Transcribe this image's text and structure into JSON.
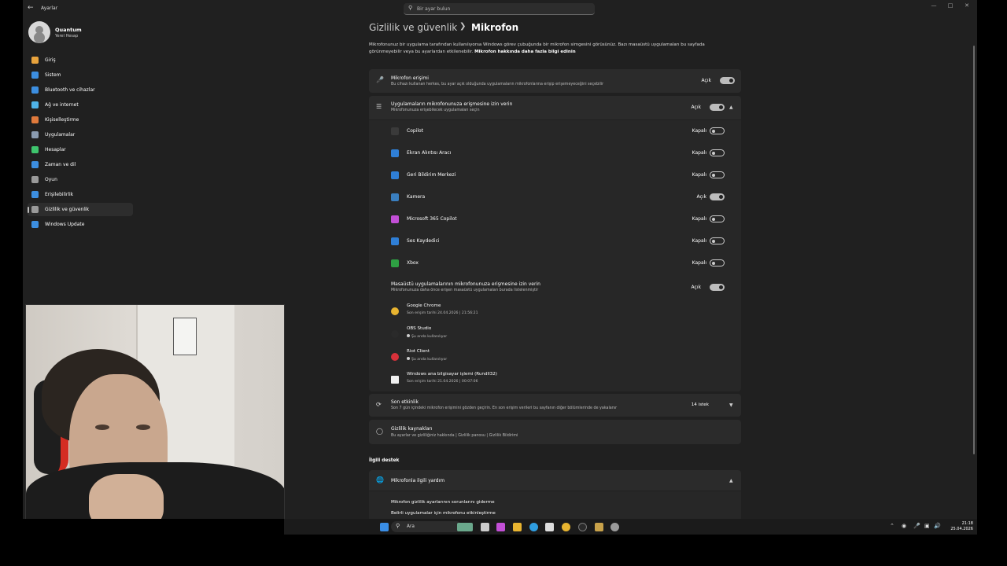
{
  "window": {
    "app_title": "Ayarlar",
    "search_placeholder": "Bir ayar bulun"
  },
  "account": {
    "name": "Quantum",
    "type": "Yerel Hesap"
  },
  "sidebar": {
    "items": [
      {
        "label": "Giriş",
        "icon": "home-icon",
        "color": "#e8a33d"
      },
      {
        "label": "Sistem",
        "icon": "system-icon",
        "color": "#3c8ee0"
      },
      {
        "label": "Bluetooth ve cihazlar",
        "icon": "bluetooth-icon",
        "color": "#3c8ee0"
      },
      {
        "label": "Ağ ve internet",
        "icon": "network-icon",
        "color": "#4fb3e8"
      },
      {
        "label": "Kişiselleştirme",
        "icon": "brush-icon",
        "color": "#e07a3c"
      },
      {
        "label": "Uygulamalar",
        "icon": "apps-icon",
        "color": "#8a9bb0"
      },
      {
        "label": "Hesaplar",
        "icon": "account-icon",
        "color": "#3ec46d"
      },
      {
        "label": "Zaman ve dil",
        "icon": "globe-clock-icon",
        "color": "#3c8ee0"
      },
      {
        "label": "Oyun",
        "icon": "gamepad-icon",
        "color": "#9a9a9a"
      },
      {
        "label": "Erişilebilirlik",
        "icon": "accessibility-icon",
        "color": "#3c8ee0"
      },
      {
        "label": "Gizlilik ve güvenlik",
        "icon": "shield-icon",
        "color": "#9a9a9a"
      },
      {
        "label": "Windows Update",
        "icon": "update-icon",
        "color": "#3c8ee0"
      }
    ]
  },
  "page": {
    "breadcrumb_parent": "Gizlilik ve güvenlik",
    "breadcrumb_current": "Mikrofon",
    "description": "Mikrofonunuz bir uygulama tarafından kullanılıyorsa Windows görev çubuğunda bir mikrofon simgesini görüsünüz. Bazı masaüstü uygulamaları bu sayfada görünmeyebilir veya bu ayarlardan etkilenebilir.",
    "description_link": "Mikrofon hakkında daha fazla bilgi edinin"
  },
  "mic_access": {
    "title": "Mikrofon erişimi",
    "subtitle": "Bu cihazı kullanan herkes, bu ayar açık olduğunda uygulamaların mikrofonlarına erişip erişemeyeceğini seçebilir",
    "state": "Açık"
  },
  "app_access": {
    "title": "Uygulamaların mikrofonunuza erişmesine izin verin",
    "subtitle": "Mikrofonunuza erişebilecek uygulamaları seçin",
    "state": "Açık",
    "apps": [
      {
        "name": "Copilot",
        "state": "Kapalı",
        "on": false,
        "icon": "copilot-icon",
        "color": "#3a3a3a"
      },
      {
        "name": "Ekran Alıntısı Aracı",
        "state": "Kapalı",
        "on": false,
        "icon": "snipping-tool-icon",
        "color": "#2f7fd6"
      },
      {
        "name": "Geri Bildirim Merkezi",
        "state": "Kapalı",
        "on": false,
        "icon": "feedback-hub-icon",
        "color": "#2f7fd6"
      },
      {
        "name": "Kamera",
        "state": "Açık",
        "on": true,
        "icon": "camera-icon",
        "color": "#3a7fc0"
      },
      {
        "name": "Microsoft 365 Copilot",
        "state": "Kapalı",
        "on": false,
        "icon": "m365-copilot-icon",
        "color": "#c24fd6"
      },
      {
        "name": "Ses Kaydedici",
        "state": "Kapalı",
        "on": false,
        "icon": "voice-recorder-icon",
        "color": "#2f7fd6"
      },
      {
        "name": "Xbox",
        "state": "Kapalı",
        "on": false,
        "icon": "xbox-icon",
        "color": "#2ea043"
      }
    ]
  },
  "desktop_access": {
    "title": "Masaüstü uygulamalarının mikrofonunuza erişmesine izin verin",
    "subtitle": "Mikrofonunuza daha önce erişen masaüstü uygulamaları burada listelenmiştir",
    "state": "Açık",
    "apps": [
      {
        "name": "Google Chrome",
        "detail": "Son erişim tarihi 24.04.2026 | 21:56:21",
        "icon": "chrome-icon",
        "color": "#e8b430"
      },
      {
        "name": "OBS Studio",
        "detail": "Şu anda kullanılıyor",
        "icon": "obs-icon",
        "color": "#2a2a2a"
      },
      {
        "name": "Riot Client",
        "detail": "Şu anda kullanılıyor",
        "icon": "riot-icon",
        "color": "#d8313a"
      },
      {
        "name": "Windows ana bilgisayar işlemi (Rundll32)",
        "detail": "Son erişim tarihi 21.04.2026 | 00:07:06",
        "icon": "file-icon",
        "color": "#f0f0f0"
      }
    ]
  },
  "recent_activity": {
    "title": "Son etkinlik",
    "subtitle": "Son 7 gün içindeki mikrofon erişimini gözden geçirin. En son erişim verileri bu sayfanın diğer bölümlerinde de yakalanır",
    "count": "14 istek"
  },
  "privacy_resources": {
    "title": "Gizlilik kaynakları",
    "subtitle": "Bu ayarlar ve gizliliğiniz hakkında | Gizlilik panosu | Gizlilik Bildirimi"
  },
  "related": {
    "heading": "İlgili destek",
    "help_title": "Mikrofonla ilgili yardım",
    "links": [
      "Mikrofon gizlilik ayarlarının sorunlarını giderme",
      "Belirli uygulamalar için mikrofonu etkinleştirme"
    ]
  },
  "taskbar": {
    "search_label": "Ara",
    "time": "21:18",
    "date": "25.04.2026"
  }
}
